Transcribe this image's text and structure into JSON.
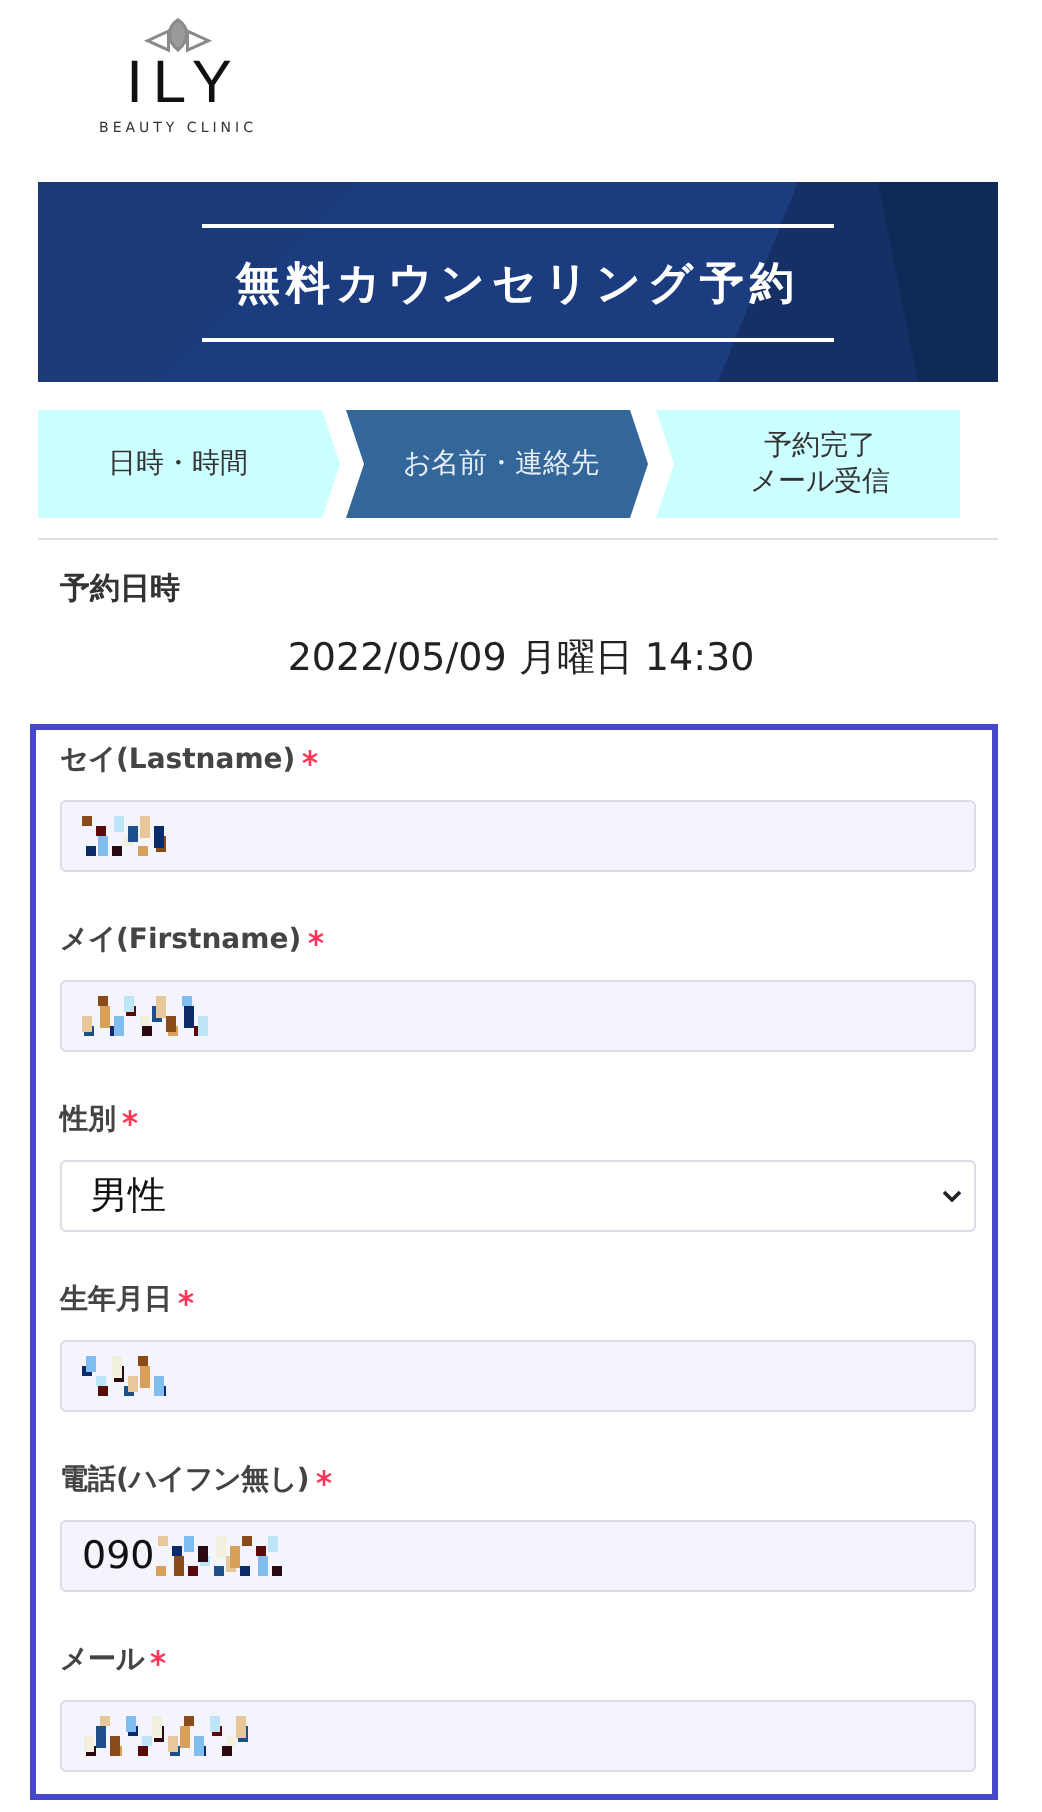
{
  "logo": {
    "name": "ILY",
    "tagline": "BEAUTY CLINIC"
  },
  "banner": {
    "title": "無料カウンセリング予約"
  },
  "steps": [
    {
      "lines": [
        "日時・時間"
      ],
      "selected": false
    },
    {
      "lines": [
        "お名前・連絡先"
      ],
      "selected": true
    },
    {
      "lines": [
        "予約完了",
        "メール受信"
      ],
      "selected": false
    }
  ],
  "reservation": {
    "label": "予約日時",
    "value": "2022/05/09 月曜日 14:30"
  },
  "form": {
    "fields": [
      {
        "kind": "text",
        "label": "セイ(Lastname)",
        "required": true,
        "redacted": true
      },
      {
        "kind": "text",
        "label": "メイ(Firstname)",
        "required": true,
        "redacted": true
      },
      {
        "kind": "select",
        "label": "性別",
        "required": true,
        "value": "男性"
      },
      {
        "kind": "text",
        "label": "生年月日",
        "required": true,
        "redacted": true
      },
      {
        "kind": "text",
        "label": "電話(ハイフン無し)",
        "required": true,
        "value": "090",
        "redacted": true
      },
      {
        "kind": "text",
        "label": "メール",
        "required": true,
        "redacted": true
      }
    ]
  }
}
